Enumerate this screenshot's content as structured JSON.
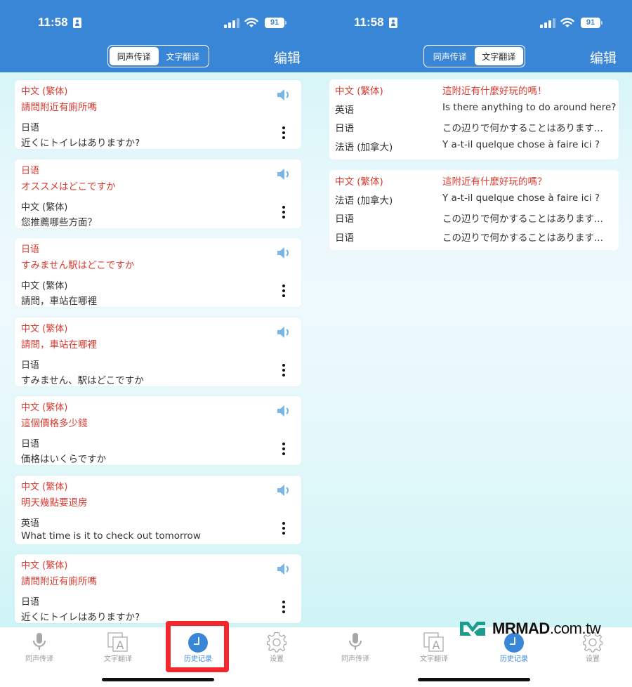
{
  "status_bar": {
    "time": "11:58",
    "battery": "91"
  },
  "header": {
    "segments": [
      "同声传译",
      "文字翻译"
    ],
    "edit_label": "编辑"
  },
  "left_screen": {
    "active_segment": "同声传译",
    "cards": [
      {
        "src_lang": "中文 (繁体)",
        "src_text": "請問附近有廁所嗎",
        "dst_lang": "日语",
        "dst_text": "近くにトイレはありますか?"
      },
      {
        "src_lang": "日语",
        "src_text": "オススメはどこですか",
        "dst_lang": "中文 (繁体)",
        "dst_text": "您推薦哪些方面？"
      },
      {
        "src_lang": "日语",
        "src_text": "すみません駅はどこですか",
        "dst_lang": "中文 (繁体)",
        "dst_text": "請問，車站在哪裡"
      },
      {
        "src_lang": "中文 (繁体)",
        "src_text": "請問，車站在哪裡",
        "dst_lang": "日语",
        "dst_text": "すみません、駅はどこですか"
      },
      {
        "src_lang": "中文 (繁体)",
        "src_text": "這個價格多少錢",
        "dst_lang": "日语",
        "dst_text": "価格はいくらですか"
      },
      {
        "src_lang": "中文 (繁体)",
        "src_text": "明天幾點要退房",
        "dst_lang": "英语",
        "dst_text": "What time is it to check out tomorrow"
      },
      {
        "src_lang": "中文 (繁体)",
        "src_text": "請問附近有廁所嗎",
        "dst_lang": "日语",
        "dst_text": "近くにトイレはありますか?"
      }
    ]
  },
  "right_screen": {
    "active_segment": "文字翻译",
    "cards": [
      {
        "rows": [
          {
            "lang": "中文 (繁体)",
            "text": "這附近有什麼好玩的嗎！",
            "source": true
          },
          {
            "lang": "英语",
            "text": "Is there anything to do around here?"
          },
          {
            "lang": "日语",
            "text": "この辺りで何かすることはあります..."
          },
          {
            "lang": "法语 (加拿大)",
            "text": "Y a-t-il quelque chose à faire ici ?"
          }
        ]
      },
      {
        "rows": [
          {
            "lang": "中文 (繁体)",
            "text": "這附近有什麼好玩的嗎？",
            "source": true
          },
          {
            "lang": "法语 (加拿大)",
            "text": "Y a-t-il quelque chose à faire ici ?"
          },
          {
            "lang": "日语",
            "text": "この辺りで何かすることはあります..."
          },
          {
            "lang": "日语",
            "text": "この辺りで何かすることはあります..."
          }
        ]
      }
    ]
  },
  "tab_bar": {
    "tabs": [
      {
        "label": "同声传译",
        "icon": "microphone-icon"
      },
      {
        "label": "文字翻译",
        "icon": "text-translate-icon"
      },
      {
        "label": "历史记录",
        "icon": "clock-icon",
        "active": true
      },
      {
        "label": "设置",
        "icon": "gear-icon"
      }
    ]
  },
  "watermark": {
    "brand": "MRMAD",
    "suffix": ".com.tw"
  },
  "colors": {
    "header_blue": "#3a86d6",
    "source_red": "#d93a2f",
    "highlight_red": "#f3282d",
    "speaker_blue": "#7ab6e6"
  }
}
